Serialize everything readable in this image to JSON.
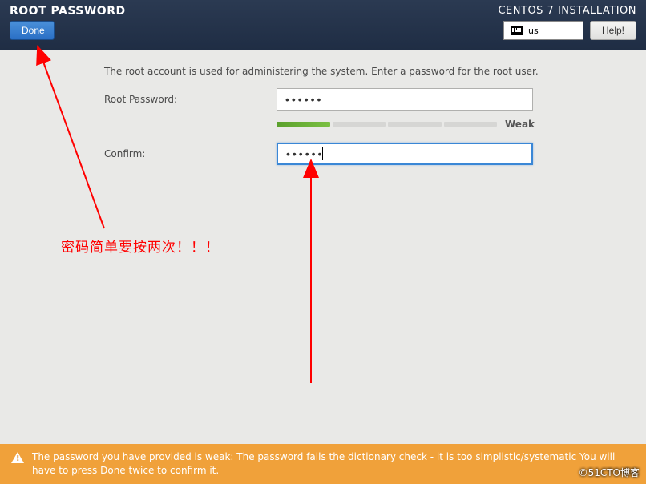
{
  "header": {
    "title": "ROOT PASSWORD",
    "done_label": "Done",
    "install_title": "CENTOS 7 INSTALLATION",
    "kb_layout": "us",
    "help_label": "Help!"
  },
  "content": {
    "instruction": "The root account is used for administering the system.  Enter a password for the root user.",
    "password_label": "Root Password:",
    "password_value": "••••••",
    "confirm_label": "Confirm:",
    "confirm_value": "••••••",
    "strength_label": "Weak"
  },
  "annotation": {
    "text": "密码简单要按两次！！！"
  },
  "warning": {
    "text": "The password you have provided is weak: The password fails the dictionary check - it is too simplistic/systematic You will have to press Done twice to confirm it."
  },
  "watermark": "©51CTO博客"
}
